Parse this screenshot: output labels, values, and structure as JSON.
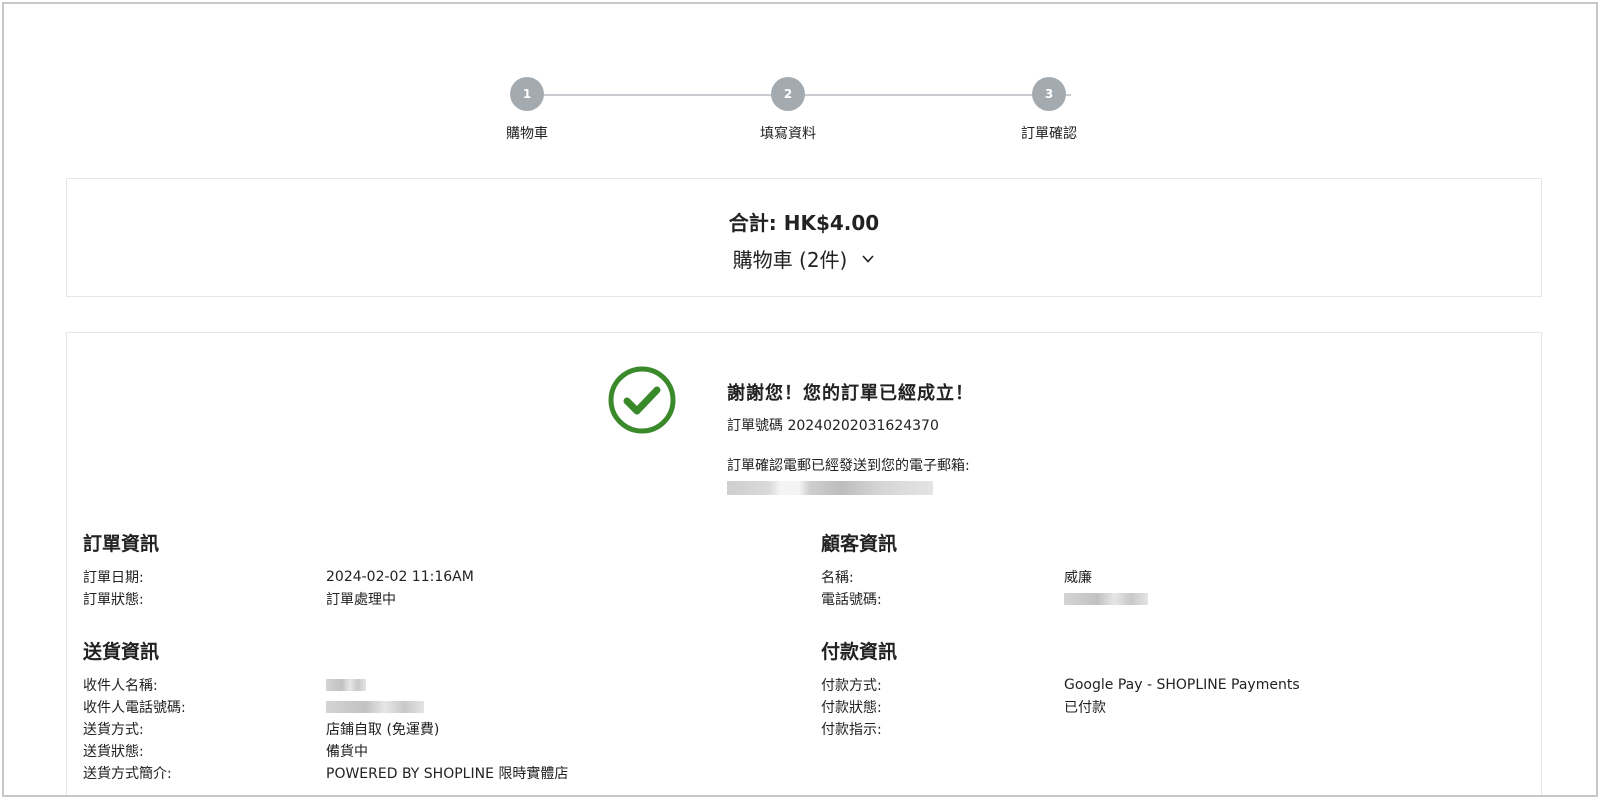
{
  "stepper": {
    "steps": [
      {
        "num": "1",
        "label": "購物車"
      },
      {
        "num": "2",
        "label": "填寫資料"
      },
      {
        "num": "3",
        "label": "訂單確認"
      }
    ]
  },
  "summary": {
    "total": "合計: HK$4.00",
    "cart_label": "購物車 (2件)"
  },
  "confirmation": {
    "thanks": "謝謝您！您的訂單已經成立！",
    "order_number": "訂單號碼 20240202031624370",
    "email_note": "訂單確認電郵已經發送到您的電子郵箱:"
  },
  "order_info": {
    "title": "訂單資訊",
    "date_label": "訂單日期:",
    "date_value": "2024-02-02 11:16AM",
    "status_label": "訂單狀態:",
    "status_value": "訂單處理中"
  },
  "customer_info": {
    "title": "顧客資訊",
    "name_label": "名稱:",
    "name_value": "威廉",
    "phone_label": "電話號碼:"
  },
  "delivery_info": {
    "title": "送貨資訊",
    "recipient_label": "收件人名稱:",
    "recipient_phone_label": "收件人電話號碼:",
    "method_label": "送貨方式:",
    "method_value": "店鋪自取 (免運費)",
    "status_label": "送貨狀態:",
    "status_value": "備貨中",
    "desc_label": "送貨方式簡介:",
    "desc_value": "POWERED BY SHOPLINE 限時實體店"
  },
  "payment_info": {
    "title": "付款資訊",
    "method_label": "付款方式:",
    "method_value": "Google Pay - SHOPLINE Payments",
    "status_label": "付款狀態:",
    "status_value": "已付款",
    "instructions_label": "付款指示:"
  },
  "colors": {
    "step_circle": "#a3aab0",
    "success_green": "#3a8a2b"
  }
}
